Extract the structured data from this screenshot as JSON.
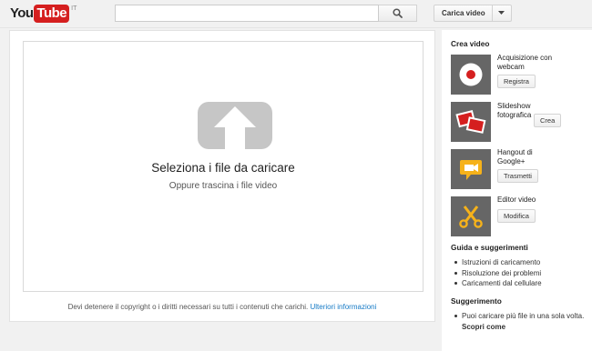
{
  "header": {
    "logo": {
      "you": "You",
      "tube": "Tube",
      "country": "IT"
    },
    "search": {
      "value": "",
      "placeholder": ""
    },
    "upload_button": {
      "label": "Carica video"
    }
  },
  "main": {
    "drop_zone": {
      "title": "Seleziona i file da caricare",
      "subtitle": "Oppure trascina i file video"
    },
    "copyright": {
      "text": "Devi detenere il copyright o i diritti necessari su tutti i contenuti che carichi.",
      "link": "Ulteriori informazioni"
    }
  },
  "sidebar": {
    "create_heading": "Crea video",
    "tools": [
      {
        "label": "Acquisizione con webcam",
        "button": "Registra",
        "icon": "webcam-record-icon",
        "color": "#d51f1f"
      },
      {
        "label": "Slideshow fotografica",
        "button": "Crea",
        "icon": "photo-slideshow-icon",
        "color": "#d51f1f"
      },
      {
        "label": "Hangout di Google+",
        "button": "Trasmetti",
        "icon": "hangout-camera-icon",
        "color": "#f6b21a"
      },
      {
        "label": "Editor video",
        "button": "Modifica",
        "icon": "scissors-icon",
        "color": "#f6b21a"
      }
    ],
    "guide_heading": "Guida e suggerimenti",
    "guide_items": [
      "Istruzioni di caricamento",
      "Risoluzione dei problemi",
      "Caricamenti dal cellulare"
    ],
    "tip_heading": "Suggerimento",
    "tip_text": "Puoi caricare più file in una sola volta.",
    "tip_link": "Scopri come"
  }
}
